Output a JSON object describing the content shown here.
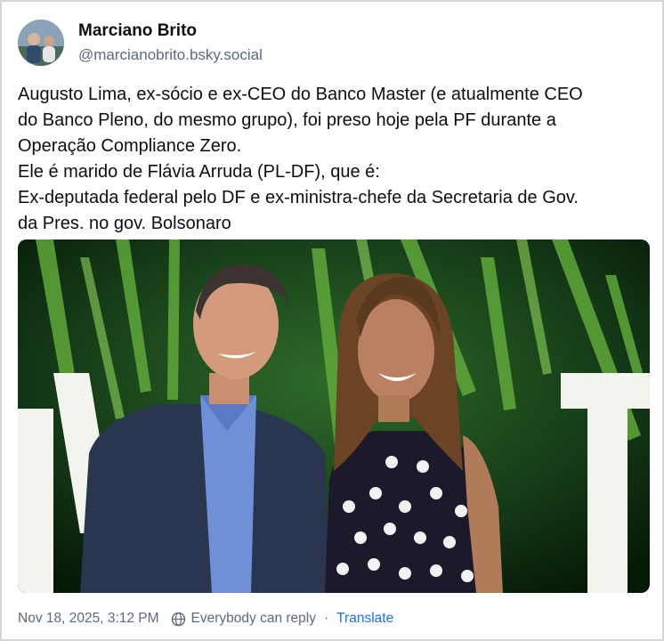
{
  "author": {
    "display_name": "Marciano Brito",
    "handle": "@marcianobrito.bsky.social"
  },
  "post": {
    "lines": [
      "Augusto Lima, ex-sócio e ex-CEO do Banco Master (e atualmente CEO",
      "do Banco Pleno, do mesmo grupo), foi preso hoje pela PF durante a",
      "Operação Compliance Zero.",
      "Ele é marido de Flávia Arruda (PL-DF), que é:",
      "Ex-deputada federal pelo DF e ex-ministra-chefe da Secretaria de Gov.",
      "da Pres. no gov. Bolsonaro"
    ]
  },
  "footer": {
    "timestamp": "Nov 18, 2025, 3:12 PM",
    "reply_setting": "Everybody can reply",
    "separator": "·",
    "translate_label": "Translate"
  },
  "icons": {
    "reply_setting": "globe-reply-icon"
  },
  "colors": {
    "text": "#0b0f14",
    "muted": "#5a6b7b",
    "link": "#1a73e8"
  }
}
